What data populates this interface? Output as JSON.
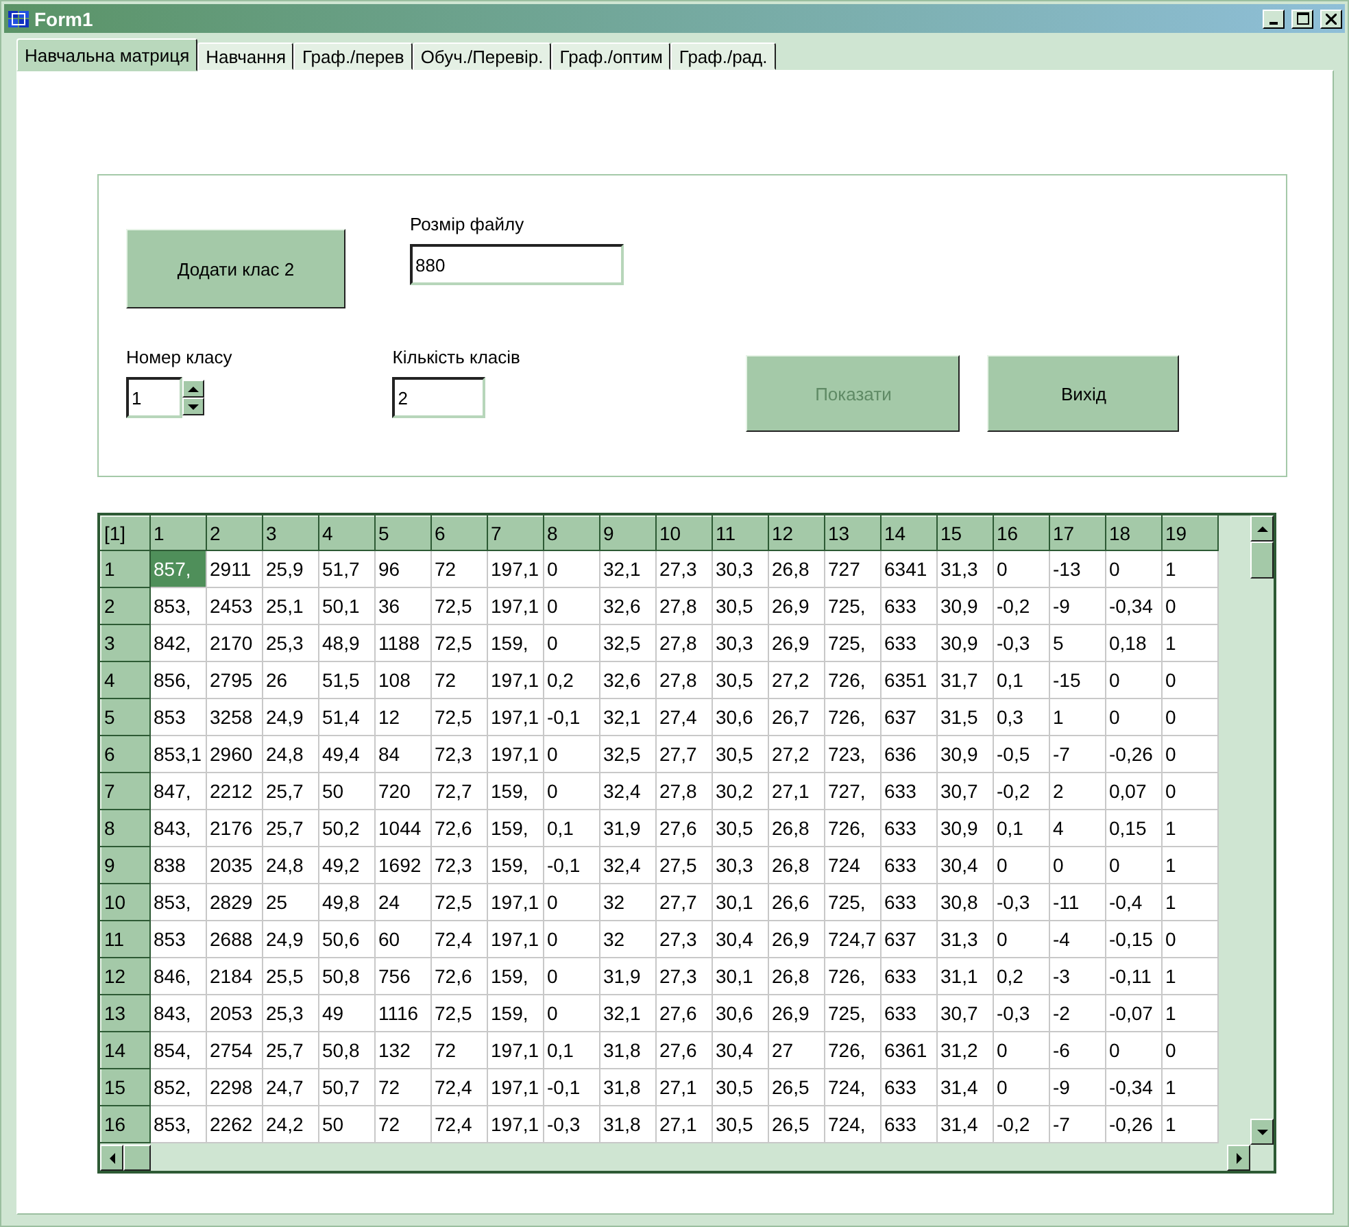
{
  "window": {
    "title": "Form1"
  },
  "tabs": [
    {
      "label": "Навчальна матриця",
      "selected": true
    },
    {
      "label": "Навчання",
      "selected": false
    },
    {
      "label": "Граф./перев",
      "selected": false
    },
    {
      "label": "Обуч./Перевір.",
      "selected": false
    },
    {
      "label": "Граф./оптим",
      "selected": false
    },
    {
      "label": "Граф./рад.",
      "selected": false
    }
  ],
  "form": {
    "add_class_button": "Додати клас 2",
    "file_size": {
      "label": "Розмір файлу",
      "value": "880"
    },
    "class_number": {
      "label": "Номер класу",
      "value": "1"
    },
    "class_count": {
      "label": "Кількість класів",
      "value": "2"
    },
    "buttons": [
      {
        "label": "Показати",
        "disabled": true
      },
      {
        "label": "Вихід",
        "disabled": false
      }
    ]
  },
  "grid": {
    "corner": "[1]",
    "columns": [
      "1",
      "2",
      "3",
      "4",
      "5",
      "6",
      "7",
      "8",
      "9",
      "10",
      "11",
      "12",
      "13",
      "14",
      "15",
      "16",
      "17",
      "18",
      "19"
    ],
    "rows": [
      {
        "header": "1",
        "cells": [
          {
            "text": "857,",
            "selected": true
          },
          {
            "text": "2911",
            "selected": false
          },
          {
            "text": "25,9",
            "selected": false
          },
          {
            "text": "51,7",
            "selected": false
          },
          {
            "text": "96",
            "selected": false
          },
          {
            "text": "72",
            "selected": false
          },
          {
            "text": "197,1",
            "selected": false
          },
          {
            "text": "0",
            "selected": false
          },
          {
            "text": "32,1",
            "selected": false
          },
          {
            "text": "27,3",
            "selected": false
          },
          {
            "text": "30,3",
            "selected": false
          },
          {
            "text": "26,8",
            "selected": false
          },
          {
            "text": "727",
            "selected": false
          },
          {
            "text": "6341",
            "selected": false
          },
          {
            "text": "31,3",
            "selected": false
          },
          {
            "text": "0",
            "selected": false
          },
          {
            "text": "-13",
            "selected": false
          },
          {
            "text": "0",
            "selected": false
          },
          {
            "text": "1",
            "selected": false
          }
        ]
      },
      {
        "header": "2",
        "cells": [
          {
            "text": "853,",
            "selected": false
          },
          {
            "text": "2453",
            "selected": false
          },
          {
            "text": "25,1",
            "selected": false
          },
          {
            "text": "50,1",
            "selected": false
          },
          {
            "text": "36",
            "selected": false
          },
          {
            "text": "72,5",
            "selected": false
          },
          {
            "text": "197,1",
            "selected": false
          },
          {
            "text": "0",
            "selected": false
          },
          {
            "text": "32,6",
            "selected": false
          },
          {
            "text": "27,8",
            "selected": false
          },
          {
            "text": "30,5",
            "selected": false
          },
          {
            "text": "26,9",
            "selected": false
          },
          {
            "text": "725,",
            "selected": false
          },
          {
            "text": "633",
            "selected": false
          },
          {
            "text": "30,9",
            "selected": false
          },
          {
            "text": "-0,2",
            "selected": false
          },
          {
            "text": "-9",
            "selected": false
          },
          {
            "text": "-0,34",
            "selected": false
          },
          {
            "text": "0",
            "selected": false
          }
        ]
      },
      {
        "header": "3",
        "cells": [
          {
            "text": "842,",
            "selected": false
          },
          {
            "text": "2170",
            "selected": false
          },
          {
            "text": "25,3",
            "selected": false
          },
          {
            "text": "48,9",
            "selected": false
          },
          {
            "text": "1188",
            "selected": false
          },
          {
            "text": "72,5",
            "selected": false
          },
          {
            "text": "159,",
            "selected": false
          },
          {
            "text": "0",
            "selected": false
          },
          {
            "text": "32,5",
            "selected": false
          },
          {
            "text": "27,8",
            "selected": false
          },
          {
            "text": "30,3",
            "selected": false
          },
          {
            "text": "26,9",
            "selected": false
          },
          {
            "text": "725,",
            "selected": false
          },
          {
            "text": "633",
            "selected": false
          },
          {
            "text": "30,9",
            "selected": false
          },
          {
            "text": "-0,3",
            "selected": false
          },
          {
            "text": "5",
            "selected": false
          },
          {
            "text": "0,18",
            "selected": false
          },
          {
            "text": "1",
            "selected": false
          }
        ]
      },
      {
        "header": "4",
        "cells": [
          {
            "text": "856,",
            "selected": false
          },
          {
            "text": "2795",
            "selected": false
          },
          {
            "text": "26",
            "selected": false
          },
          {
            "text": "51,5",
            "selected": false
          },
          {
            "text": "108",
            "selected": false
          },
          {
            "text": "72",
            "selected": false
          },
          {
            "text": "197,1",
            "selected": false
          },
          {
            "text": "0,2",
            "selected": false
          },
          {
            "text": "32,6",
            "selected": false
          },
          {
            "text": "27,8",
            "selected": false
          },
          {
            "text": "30,5",
            "selected": false
          },
          {
            "text": "27,2",
            "selected": false
          },
          {
            "text": "726,",
            "selected": false
          },
          {
            "text": "6351",
            "selected": false
          },
          {
            "text": "31,7",
            "selected": false
          },
          {
            "text": "0,1",
            "selected": false
          },
          {
            "text": "-15",
            "selected": false
          },
          {
            "text": "0",
            "selected": false
          },
          {
            "text": "0",
            "selected": false
          }
        ]
      },
      {
        "header": "5",
        "cells": [
          {
            "text": "853",
            "selected": false
          },
          {
            "text": "3258",
            "selected": false
          },
          {
            "text": "24,9",
            "selected": false
          },
          {
            "text": "51,4",
            "selected": false
          },
          {
            "text": "12",
            "selected": false
          },
          {
            "text": "72,5",
            "selected": false
          },
          {
            "text": "197,1",
            "selected": false
          },
          {
            "text": "-0,1",
            "selected": false
          },
          {
            "text": "32,1",
            "selected": false
          },
          {
            "text": "27,4",
            "selected": false
          },
          {
            "text": "30,6",
            "selected": false
          },
          {
            "text": "26,7",
            "selected": false
          },
          {
            "text": "726,",
            "selected": false
          },
          {
            "text": "637",
            "selected": false
          },
          {
            "text": "31,5",
            "selected": false
          },
          {
            "text": "0,3",
            "selected": false
          },
          {
            "text": "1",
            "selected": false
          },
          {
            "text": "0",
            "selected": false
          },
          {
            "text": "0",
            "selected": false
          }
        ]
      },
      {
        "header": "6",
        "cells": [
          {
            "text": "853,1",
            "selected": false
          },
          {
            "text": "2960",
            "selected": false
          },
          {
            "text": "24,8",
            "selected": false
          },
          {
            "text": "49,4",
            "selected": false
          },
          {
            "text": "84",
            "selected": false
          },
          {
            "text": "72,3",
            "selected": false
          },
          {
            "text": "197,1",
            "selected": false
          },
          {
            "text": "0",
            "selected": false
          },
          {
            "text": "32,5",
            "selected": false
          },
          {
            "text": "27,7",
            "selected": false
          },
          {
            "text": "30,5",
            "selected": false
          },
          {
            "text": "27,2",
            "selected": false
          },
          {
            "text": "723,",
            "selected": false
          },
          {
            "text": "636",
            "selected": false
          },
          {
            "text": "30,9",
            "selected": false
          },
          {
            "text": "-0,5",
            "selected": false
          },
          {
            "text": "-7",
            "selected": false
          },
          {
            "text": "-0,26",
            "selected": false
          },
          {
            "text": "0",
            "selected": false
          }
        ]
      },
      {
        "header": "7",
        "cells": [
          {
            "text": "847,",
            "selected": false
          },
          {
            "text": "2212",
            "selected": false
          },
          {
            "text": "25,7",
            "selected": false
          },
          {
            "text": "50",
            "selected": false
          },
          {
            "text": "720",
            "selected": false
          },
          {
            "text": "72,7",
            "selected": false
          },
          {
            "text": "159,",
            "selected": false
          },
          {
            "text": "0",
            "selected": false
          },
          {
            "text": "32,4",
            "selected": false
          },
          {
            "text": "27,8",
            "selected": false
          },
          {
            "text": "30,2",
            "selected": false
          },
          {
            "text": "27,1",
            "selected": false
          },
          {
            "text": "727,",
            "selected": false
          },
          {
            "text": "633",
            "selected": false
          },
          {
            "text": "30,7",
            "selected": false
          },
          {
            "text": "-0,2",
            "selected": false
          },
          {
            "text": "2",
            "selected": false
          },
          {
            "text": "0,07",
            "selected": false
          },
          {
            "text": "0",
            "selected": false
          }
        ]
      },
      {
        "header": "8",
        "cells": [
          {
            "text": "843,",
            "selected": false
          },
          {
            "text": "2176",
            "selected": false
          },
          {
            "text": "25,7",
            "selected": false
          },
          {
            "text": "50,2",
            "selected": false
          },
          {
            "text": "1044",
            "selected": false
          },
          {
            "text": "72,6",
            "selected": false
          },
          {
            "text": "159,",
            "selected": false
          },
          {
            "text": "0,1",
            "selected": false
          },
          {
            "text": "31,9",
            "selected": false
          },
          {
            "text": "27,6",
            "selected": false
          },
          {
            "text": "30,5",
            "selected": false
          },
          {
            "text": "26,8",
            "selected": false
          },
          {
            "text": "726,",
            "selected": false
          },
          {
            "text": "633",
            "selected": false
          },
          {
            "text": "30,9",
            "selected": false
          },
          {
            "text": "0,1",
            "selected": false
          },
          {
            "text": "4",
            "selected": false
          },
          {
            "text": "0,15",
            "selected": false
          },
          {
            "text": "1",
            "selected": false
          }
        ]
      },
      {
        "header": "9",
        "cells": [
          {
            "text": "838",
            "selected": false
          },
          {
            "text": "2035",
            "selected": false
          },
          {
            "text": "24,8",
            "selected": false
          },
          {
            "text": "49,2",
            "selected": false
          },
          {
            "text": "1692",
            "selected": false
          },
          {
            "text": "72,3",
            "selected": false
          },
          {
            "text": "159,",
            "selected": false
          },
          {
            "text": "-0,1",
            "selected": false
          },
          {
            "text": "32,4",
            "selected": false
          },
          {
            "text": "27,5",
            "selected": false
          },
          {
            "text": "30,3",
            "selected": false
          },
          {
            "text": "26,8",
            "selected": false
          },
          {
            "text": "724",
            "selected": false
          },
          {
            "text": "633",
            "selected": false
          },
          {
            "text": "30,4",
            "selected": false
          },
          {
            "text": "0",
            "selected": false
          },
          {
            "text": "0",
            "selected": false
          },
          {
            "text": "0",
            "selected": false
          },
          {
            "text": "1",
            "selected": false
          }
        ]
      },
      {
        "header": "10",
        "cells": [
          {
            "text": "853,",
            "selected": false
          },
          {
            "text": "2829",
            "selected": false
          },
          {
            "text": "25",
            "selected": false
          },
          {
            "text": "49,8",
            "selected": false
          },
          {
            "text": "24",
            "selected": false
          },
          {
            "text": "72,5",
            "selected": false
          },
          {
            "text": "197,1",
            "selected": false
          },
          {
            "text": "0",
            "selected": false
          },
          {
            "text": "32",
            "selected": false
          },
          {
            "text": "27,7",
            "selected": false
          },
          {
            "text": "30,1",
            "selected": false
          },
          {
            "text": "26,6",
            "selected": false
          },
          {
            "text": "725,",
            "selected": false
          },
          {
            "text": "633",
            "selected": false
          },
          {
            "text": "30,8",
            "selected": false
          },
          {
            "text": "-0,3",
            "selected": false
          },
          {
            "text": "-11",
            "selected": false
          },
          {
            "text": "-0,4",
            "selected": false
          },
          {
            "text": "1",
            "selected": false
          }
        ]
      },
      {
        "header": "11",
        "cells": [
          {
            "text": "853",
            "selected": false
          },
          {
            "text": "2688",
            "selected": false
          },
          {
            "text": "24,9",
            "selected": false
          },
          {
            "text": "50,6",
            "selected": false
          },
          {
            "text": "60",
            "selected": false
          },
          {
            "text": "72,4",
            "selected": false
          },
          {
            "text": "197,1",
            "selected": false
          },
          {
            "text": "0",
            "selected": false
          },
          {
            "text": "32",
            "selected": false
          },
          {
            "text": "27,3",
            "selected": false
          },
          {
            "text": "30,4",
            "selected": false
          },
          {
            "text": "26,9",
            "selected": false
          },
          {
            "text": "724,7",
            "selected": false
          },
          {
            "text": "637",
            "selected": false
          },
          {
            "text": "31,3",
            "selected": false
          },
          {
            "text": "0",
            "selected": false
          },
          {
            "text": "-4",
            "selected": false
          },
          {
            "text": "-0,15",
            "selected": false
          },
          {
            "text": "0",
            "selected": false
          }
        ]
      },
      {
        "header": "12",
        "cells": [
          {
            "text": "846,",
            "selected": false
          },
          {
            "text": "2184",
            "selected": false
          },
          {
            "text": "25,5",
            "selected": false
          },
          {
            "text": "50,8",
            "selected": false
          },
          {
            "text": "756",
            "selected": false
          },
          {
            "text": "72,6",
            "selected": false
          },
          {
            "text": "159,",
            "selected": false
          },
          {
            "text": "0",
            "selected": false
          },
          {
            "text": "31,9",
            "selected": false
          },
          {
            "text": "27,3",
            "selected": false
          },
          {
            "text": "30,1",
            "selected": false
          },
          {
            "text": "26,8",
            "selected": false
          },
          {
            "text": "726,",
            "selected": false
          },
          {
            "text": "633",
            "selected": false
          },
          {
            "text": "31,1",
            "selected": false
          },
          {
            "text": "0,2",
            "selected": false
          },
          {
            "text": "-3",
            "selected": false
          },
          {
            "text": "-0,11",
            "selected": false
          },
          {
            "text": "1",
            "selected": false
          }
        ]
      },
      {
        "header": "13",
        "cells": [
          {
            "text": "843,",
            "selected": false
          },
          {
            "text": "2053",
            "selected": false
          },
          {
            "text": "25,3",
            "selected": false
          },
          {
            "text": "49",
            "selected": false
          },
          {
            "text": "1116",
            "selected": false
          },
          {
            "text": "72,5",
            "selected": false
          },
          {
            "text": "159,",
            "selected": false
          },
          {
            "text": "0",
            "selected": false
          },
          {
            "text": "32,1",
            "selected": false
          },
          {
            "text": "27,6",
            "selected": false
          },
          {
            "text": "30,6",
            "selected": false
          },
          {
            "text": "26,9",
            "selected": false
          },
          {
            "text": "725,",
            "selected": false
          },
          {
            "text": "633",
            "selected": false
          },
          {
            "text": "30,7",
            "selected": false
          },
          {
            "text": "-0,3",
            "selected": false
          },
          {
            "text": "-2",
            "selected": false
          },
          {
            "text": "-0,07",
            "selected": false
          },
          {
            "text": "1",
            "selected": false
          }
        ]
      },
      {
        "header": "14",
        "cells": [
          {
            "text": "854,",
            "selected": false
          },
          {
            "text": "2754",
            "selected": false
          },
          {
            "text": "25,7",
            "selected": false
          },
          {
            "text": "50,8",
            "selected": false
          },
          {
            "text": "132",
            "selected": false
          },
          {
            "text": "72",
            "selected": false
          },
          {
            "text": "197,1",
            "selected": false
          },
          {
            "text": "0,1",
            "selected": false
          },
          {
            "text": "31,8",
            "selected": false
          },
          {
            "text": "27,6",
            "selected": false
          },
          {
            "text": "30,4",
            "selected": false
          },
          {
            "text": "27",
            "selected": false
          },
          {
            "text": "726,",
            "selected": false
          },
          {
            "text": "6361",
            "selected": false
          },
          {
            "text": "31,2",
            "selected": false
          },
          {
            "text": "0",
            "selected": false
          },
          {
            "text": "-6",
            "selected": false
          },
          {
            "text": "0",
            "selected": false
          },
          {
            "text": "0",
            "selected": false
          }
        ]
      },
      {
        "header": "15",
        "cells": [
          {
            "text": "852,",
            "selected": false
          },
          {
            "text": "2298",
            "selected": false
          },
          {
            "text": "24,7",
            "selected": false
          },
          {
            "text": "50,7",
            "selected": false
          },
          {
            "text": "72",
            "selected": false
          },
          {
            "text": "72,4",
            "selected": false
          },
          {
            "text": "197,1",
            "selected": false
          },
          {
            "text": "-0,1",
            "selected": false
          },
          {
            "text": "31,8",
            "selected": false
          },
          {
            "text": "27,1",
            "selected": false
          },
          {
            "text": "30,5",
            "selected": false
          },
          {
            "text": "26,5",
            "selected": false
          },
          {
            "text": "724,",
            "selected": false
          },
          {
            "text": "633",
            "selected": false
          },
          {
            "text": "31,4",
            "selected": false
          },
          {
            "text": "0",
            "selected": false
          },
          {
            "text": "-9",
            "selected": false
          },
          {
            "text": "-0,34",
            "selected": false
          },
          {
            "text": "1",
            "selected": false
          }
        ]
      },
      {
        "header": "16",
        "cells": [
          {
            "text": "853,",
            "selected": false
          },
          {
            "text": "2262",
            "selected": false
          },
          {
            "text": "24,2",
            "selected": false
          },
          {
            "text": "50",
            "selected": false
          },
          {
            "text": "72",
            "selected": false
          },
          {
            "text": "72,4",
            "selected": false
          },
          {
            "text": "197,1",
            "selected": false
          },
          {
            "text": "-0,3",
            "selected": false
          },
          {
            "text": "31,8",
            "selected": false
          },
          {
            "text": "27,1",
            "selected": false
          },
          {
            "text": "30,5",
            "selected": false
          },
          {
            "text": "26,5",
            "selected": false
          },
          {
            "text": "724,",
            "selected": false
          },
          {
            "text": "633",
            "selected": false
          },
          {
            "text": "31,4",
            "selected": false
          },
          {
            "text": "-0,2",
            "selected": false
          },
          {
            "text": "-7",
            "selected": false
          },
          {
            "text": "-0,26",
            "selected": false
          },
          {
            "text": "1",
            "selected": false
          }
        ]
      }
    ]
  }
}
